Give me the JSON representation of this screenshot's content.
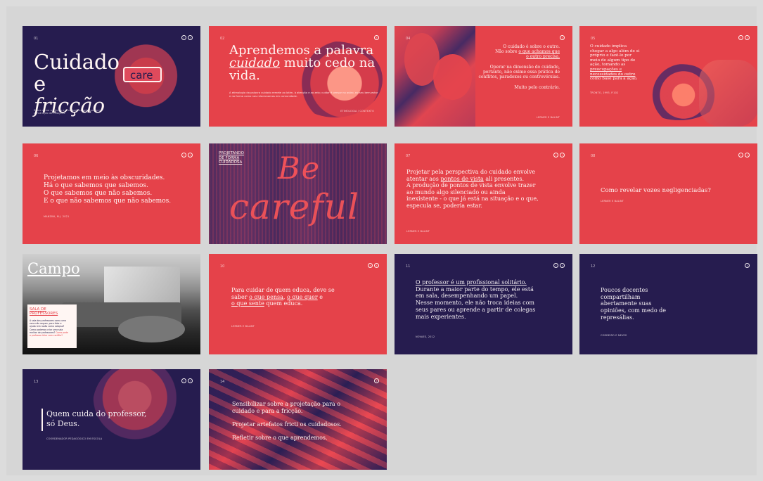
{
  "slides": [
    {
      "number": "01",
      "title_line_1": "Cuidado e",
      "title_line_2": "fricção",
      "card_text": "care",
      "footer": "Sobre como a fricção e o cuidado se relacionam na construção de relações."
    },
    {
      "number": "02",
      "title_line_1": "Aprendemos a palavra",
      "title_word": "cuidado",
      "title_line_2_rest": "muito cedo na",
      "title_line_3": "vida.",
      "body": "A etimologia da palavra cuidado remete ao latim, à atenção e ao zelo; cuidar é pensar no outro, no seu bem-estar e na forma como nos relacionamos em comunidade.",
      "meta": "ETIMOLOGIA / CONTEXTO"
    },
    {
      "number": "04",
      "line_1": "O cuidado é sobre o outro.",
      "line_2_prefix": "Não sobre",
      "line_2_link": "o que achamos que",
      "line_3_link": "o outro precisa.",
      "paragraph_2": "Operar na dimensão do cuidado, portanto, não exime essa prática de conflitos, paradoxos ou controvérsias.",
      "paragraph_3": "Muito pelo contrário.",
      "meta": "LERNER E BALINT"
    },
    {
      "number": "05",
      "line_1": "O cuidado implica",
      "line_2": "chegar a algo além de si",
      "line_3": "próprio e fazê-lo por",
      "line_4": "meio de algum tipo de",
      "line_5": "ação, tomando as",
      "line_6_link": "preocupações e",
      "line_7_link": "necessidades do outro",
      "line_8": "como base para a ação.",
      "meta": "TRONTO, 1993, p.102"
    },
    {
      "number": "06",
      "line_1": "Projetamos em meio às obscuridades.",
      "line_2": "Há o que sabemos que sabemos.",
      "line_3": "O que sabemos que não sabemos.",
      "line_4": "E o que não sabemos que não sabemos.",
      "meta": "MANZINI, M.J. 2021"
    },
    {
      "label_1": "PROJETANDO",
      "label_2": "DE FORMA",
      "label_3": "CUIDADOSA",
      "word_1": "Be",
      "word_2": "careful"
    },
    {
      "number": "07",
      "line_1": "Projetar pela perspectiva do cuidado envolve",
      "line_2_prefix": "atentar aos",
      "line_2_link": "pontos de vista",
      "line_2_suffix": "ali presentes.",
      "line_3": "A produção de pontos de vista envolve trazer",
      "line_4": "ao mundo algo silenciado ou ainda",
      "line_5": "inexistente - o que já está na situação e o que,",
      "line_6": "especula se, poderia estar.",
      "meta": "LERNER E BALINT"
    },
    {
      "number": "08",
      "question": "Como revelar vozes negligenciadas?",
      "meta": "LERNER E BALINT"
    },
    {
      "title": "Campo",
      "card_title_1": "SALA DE",
      "card_title_2": "PROFESSORES",
      "card_text_1": "A sala dos professores como uma",
      "card_text_2": "zona não segura, para falar e",
      "card_text_3": "ajudar em razão como colapso?",
      "card_text_4": "Como podemos criar uma sala",
      "card_text_5": "melhor de professores?",
      "card_highlight": "Como pode",
      "card_text_6": "o professor falar com conflito?"
    },
    {
      "number": "10",
      "line_1": "Para cuidar de quem educa, deve se",
      "line_2_prefix": "saber",
      "link_1": "o que pensa",
      "sep_1": ",",
      "link_2": "o que quer",
      "line_2_suffix": "e",
      "link_3": "o que sente",
      "line_3_suffix": "quem educa.",
      "meta": "LERNER E BALINT"
    },
    {
      "number": "11",
      "line_1_link": "O professor é um profissional solitário.",
      "line_2": "Durante a maior parte do tempo, ele está",
      "line_3": "em sala, desempenhando um papel.",
      "line_4": "Nesse momento, ele não troca ideias com",
      "line_5": "seus pares ou aprende a partir de colegas",
      "line_6": "mais experientes.",
      "meta": "NOVAES, 2012"
    },
    {
      "number": "12",
      "line_1": "Poucos docentes",
      "line_2": "compartilham",
      "line_3": "abertamente suas",
      "line_4": "opiniões, com medo de",
      "line_5": "represálias.",
      "meta": "CORDEIRO E NEVES"
    },
    {
      "number": "13",
      "quote_1": "Quem cuida do professor,",
      "quote_2": "só Deus.",
      "meta": "COORDENADOR PEDAGÓGICO EM ESCOLA"
    },
    {
      "number": "14",
      "line_1": "Sensibilizar sobre a projetação para o",
      "line_2": "cuidado e para a fricção.",
      "line_3": "Projetar artefatos fricti os cuidadosos.",
      "line_4": "Refletir sobre o que aprendemos."
    }
  ],
  "nav": {
    "prev": "‹",
    "next": "›"
  },
  "colors": {
    "navy": "#261c4f",
    "coral": "#e5424a",
    "cream": "#fff3f1"
  }
}
